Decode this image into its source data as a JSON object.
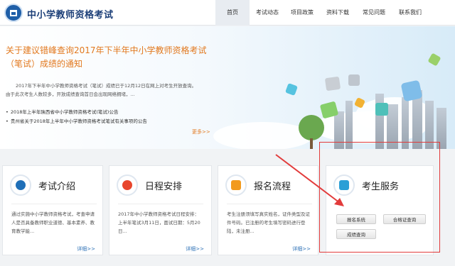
{
  "header": {
    "site_title": "中小学教师资格考试",
    "nav": [
      "首页",
      "考试动态",
      "项目政策",
      "资料下载",
      "常见问题",
      "联系我们"
    ]
  },
  "banner": {
    "news_title": "关于建议错峰查询2017年下半年中小学教师资格考试（笔试）成绩的通知",
    "news_body": "2017年下半年中小学教师资格考试（笔试）成绩已于12月12日在网上对考生开放查询。由于此次考生人数较多，开放成绩查询首日会出现网络拥堵，...",
    "bullets": [
      "2018年上半年陕西省中小学教师资格考试(笔试)公告",
      "贵州省关于2018年上半年中小学教师资格考试笔试有关事项的公告"
    ],
    "more_label": "更多>>"
  },
  "cards": [
    {
      "title": "考试介绍",
      "text": "通过实施中小学教师资格考试，考查申请人是否具备教师职业道德、基本素养、教育教学能...",
      "more": "详细>>",
      "icon": "globe-icon",
      "color": "#1f6fb8"
    },
    {
      "title": "日程安排",
      "text": "2017年中小学教师资格考试日程安排：上半年笔试3月11日，面试日期：5月20日...",
      "more": "详细>>",
      "icon": "check-icon",
      "color": "#e8452c"
    },
    {
      "title": "报名流程",
      "text": "考生注册须填写真实姓名，证件类型及证件号码。已注册的考生填写密码进行登陆，未注册...",
      "more": "详细>>",
      "icon": "form-icon",
      "color": "#f29a1e"
    },
    {
      "title": "考生服务",
      "icon": "id-card-icon",
      "color": "#2a9fd6",
      "buttons": [
        "报名系统",
        "合格证查询",
        "成绩查询"
      ]
    }
  ],
  "colors": {
    "accent_orange": "#e2791f",
    "brand_blue": "#1c3f78",
    "highlight_red": "#e23b3b"
  }
}
